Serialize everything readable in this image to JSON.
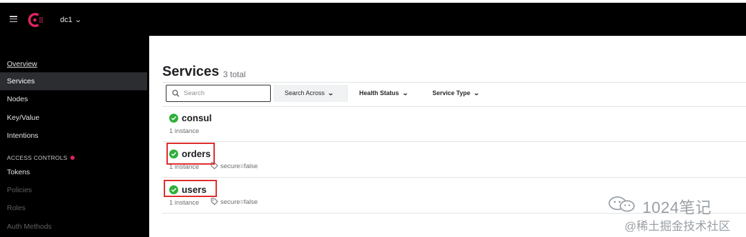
{
  "header": {
    "datacenter": "dc1",
    "icons": {
      "menu": "hamburger-icon",
      "logo": "consul-logo",
      "chevron": "chevron-down-icon"
    },
    "brand_color": "#e0245e"
  },
  "sidebar": {
    "items": [
      {
        "label": "Overview"
      },
      {
        "label": "Services"
      },
      {
        "label": "Nodes"
      },
      {
        "label": "Key/Value"
      },
      {
        "label": "Intentions"
      }
    ],
    "section": "ACCESS CONTROLS",
    "acl_items": [
      {
        "label": "Tokens"
      },
      {
        "label": "Policies"
      },
      {
        "label": "Roles"
      },
      {
        "label": "Auth Methods"
      }
    ]
  },
  "main": {
    "title": "Services",
    "count": "3 total",
    "search": {
      "placeholder": "Search",
      "icon": "search-icon"
    },
    "filters": {
      "search_across": "Search Across",
      "health_status": "Health Status",
      "service_type": "Service Type"
    },
    "services": [
      {
        "name": "consul",
        "instances": "1 instance",
        "tag": "",
        "health": "passing"
      },
      {
        "name": "orders",
        "instances": "1 instance",
        "tag": "secure=false",
        "health": "passing"
      },
      {
        "name": "users",
        "instances": "1 instance",
        "tag": "secure=false",
        "health": "passing"
      }
    ],
    "status_color": "#2eb039",
    "highlight_color": "#e02a2a"
  },
  "watermark": {
    "line1": "1024笔记",
    "line2": "@稀土掘金技术社区"
  }
}
